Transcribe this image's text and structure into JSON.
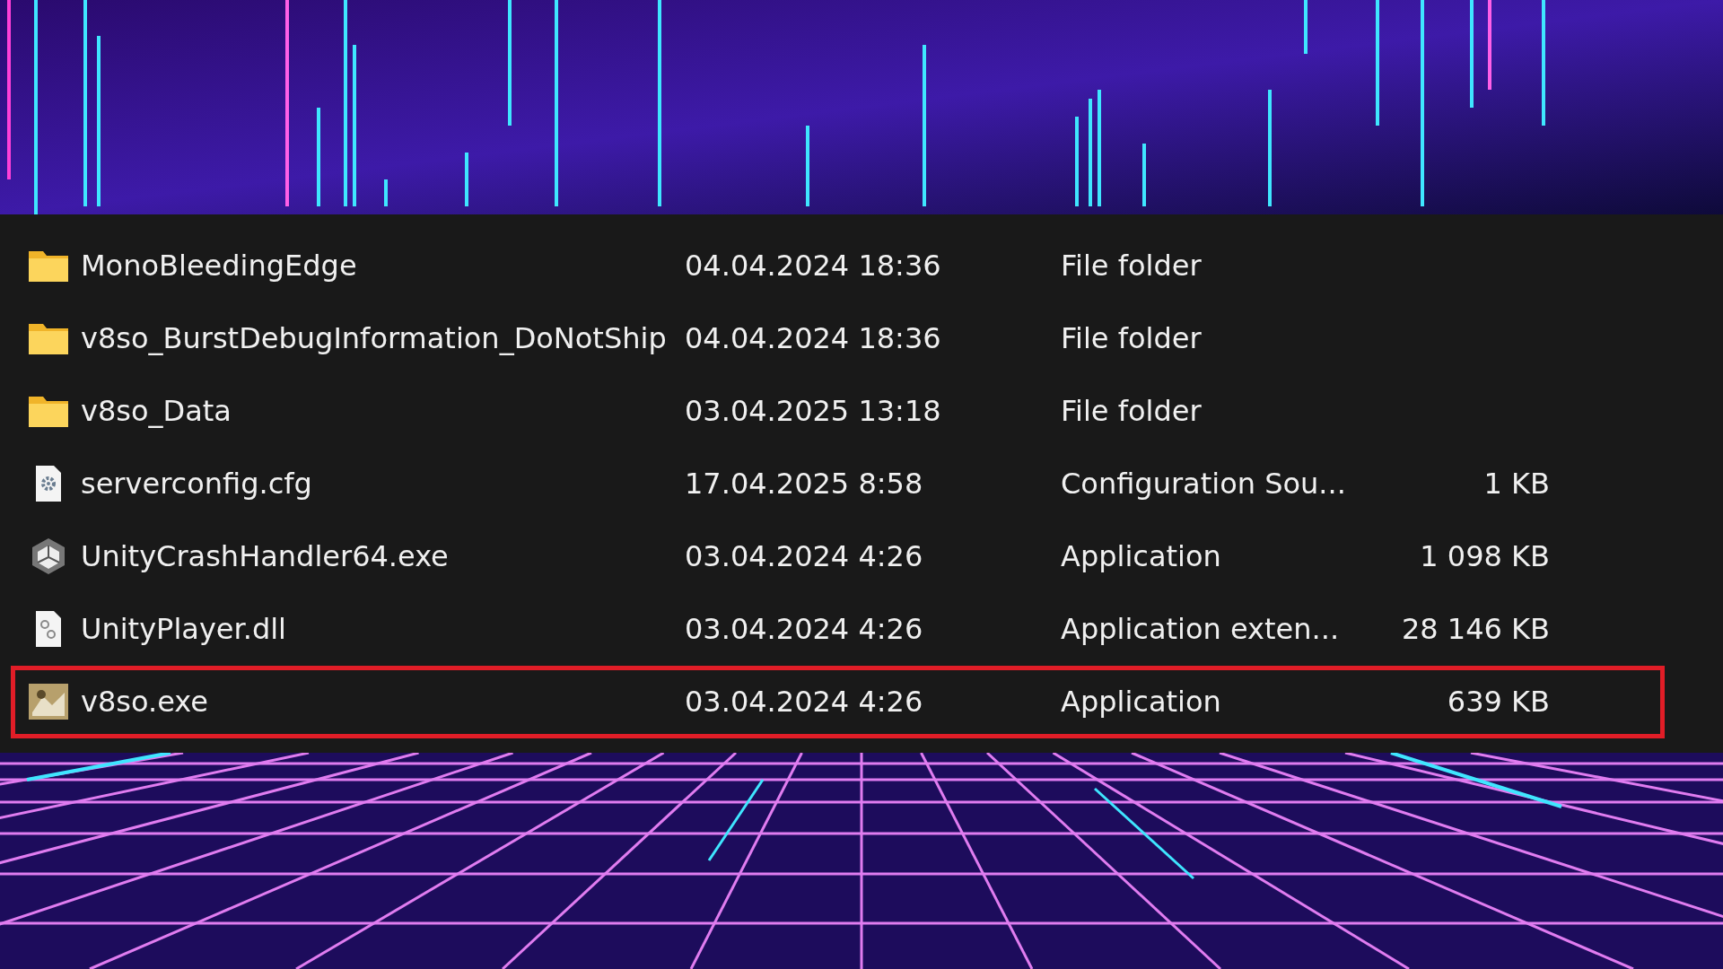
{
  "files": [
    {
      "kind": "folder",
      "name": "MonoBleedingEdge",
      "date": "04.04.2024 18:36",
      "type": "File folder",
      "highlighted": false
    },
    {
      "kind": "folder",
      "name": "v8so_BurstDebugInformation_DoNotShip",
      "date": "04.04.2024 18:36",
      "type": "File folder",
      "highlighted": false
    },
    {
      "kind": "folder",
      "name": "v8so_Data",
      "date": "03.04.2025 13:18",
      "type": "File folder",
      "highlighted": false
    },
    {
      "kind": "config",
      "name": "serverconfig.cfg",
      "date": "17.04.2025 8:58",
      "type": "Configuration Sou...",
      "size": "1 KB",
      "highlighted": false
    },
    {
      "kind": "unity-app",
      "name": "UnityCrashHandler64.exe",
      "date": "03.04.2024 4:26",
      "type": "Application",
      "size": "1 098 KB",
      "highlighted": false
    },
    {
      "kind": "dll",
      "name": "UnityPlayer.dll",
      "date": "03.04.2024 4:26",
      "type": "Application exten...",
      "size": "28 146 KB",
      "highlighted": false
    },
    {
      "kind": "image-app",
      "name": "v8so.exe",
      "date": "03.04.2024 4:26",
      "type": "Application",
      "size": "639 KB",
      "highlighted": true
    }
  ]
}
